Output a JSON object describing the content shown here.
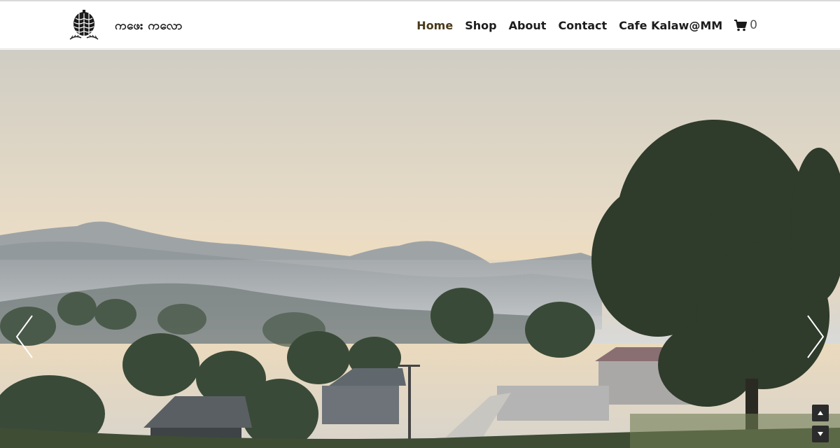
{
  "brand": {
    "name": "ကဖေး ကလော",
    "logo_icon": "pinecone-icon"
  },
  "nav": {
    "items": [
      {
        "label": "Home",
        "active": true
      },
      {
        "label": "Shop"
      },
      {
        "label": "About"
      },
      {
        "label": "Contact"
      },
      {
        "label": "Cafe Kalaw@MM"
      }
    ],
    "cart_icon": "cart-icon",
    "cart_count": "0"
  },
  "slider": {
    "prev_icon": "chevron-left-icon",
    "next_icon": "chevron-right-icon"
  },
  "scroll": {
    "up_icon": "arrow-up-icon",
    "down_icon": "arrow-down-icon"
  },
  "colors": {
    "text": "#1c1c1c",
    "active": "#4a3a1a",
    "sky_top": "#c9c8c0",
    "sky_bottom": "#f1dcb8"
  }
}
